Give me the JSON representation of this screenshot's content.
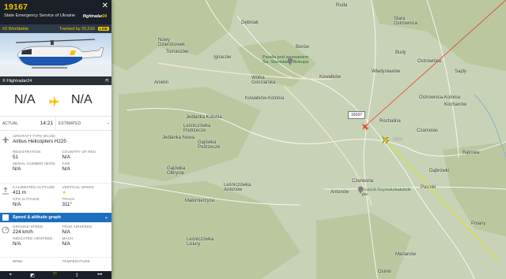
{
  "flight": {
    "callsign": "19167",
    "operator": "State Emergency Service of Ukraine",
    "rank": "#3 Worldwide",
    "tracked_by": "Tracked by 20,516",
    "badge": "LIVE",
    "photo_credit": "© Flightradar24",
    "logo": "flightradar",
    "logo_num": "24",
    "origin": "N/A",
    "destination": "N/A"
  },
  "times": {
    "actual_label": "ACTUAL",
    "actual_value": "14:21",
    "estimated_label": "ESTIMATED",
    "estimated_value": "-"
  },
  "details": {
    "aircraft_type_label": "AIRCRAFT TYPE (EC25)",
    "aircraft_type": "Airbus Helicopters H225",
    "registration_label": "REGISTRATION",
    "registration": "51",
    "country_label": "COUNTRY OF REG.",
    "country": "N/A",
    "serial_label": "SERIAL NUMBER (MSN)",
    "serial": "N/A",
    "age_label": "AGE",
    "age": "N/A",
    "cal_alt_label": "CALIBRATED ALTITUDE",
    "cal_alt": "411 m",
    "vert_speed_label": "VERTICAL SPEED",
    "gps_alt_label": "GPS ALTITUDE",
    "gps_alt": "N/A",
    "track_label": "TRACK",
    "track": "311°",
    "graph_label": "Speed & altitude graph",
    "ground_speed_label": "GROUND SPEED",
    "ground_speed": "224 km/h",
    "true_airspeed_label": "TRUE AIRSPEED",
    "true_airspeed": "N/A",
    "ind_airspeed_label": "INDICATED AIRSPEED",
    "ind_airspeed": "N/A",
    "mach_label": "MACH",
    "mach": "N/A",
    "wind_label": "WIND",
    "temp_label": "TEMPERATURE"
  },
  "map": {
    "aircraft_label": "19167",
    "other_label": "19171",
    "places": {
      "ruda": "Ruda",
      "debniak": "Dębniak",
      "stara_ostrownica": "Stara Ostrownica",
      "nowy_dzierzkowek": "Nowy Dzierzkowek",
      "tomaszow": "Tomaszów",
      "borow": "Borów",
      "ignacow": "Ignaców",
      "parafia": "Parafia pod wezwaniem Św. Stanisława Biskupa",
      "budy": "Budy",
      "ostrownica": "Ostrownica",
      "wolka_gonciarska": "Wólka Gonciarska",
      "wladyslawow": "Władysławów",
      "sajdy": "Sajdy",
      "anielin": "Anielin",
      "kowalkow": "Kowalków",
      "kowalkow_kolonia": "Kowalków-Kolonia",
      "ostrownica_kolonia": "Ostrownica-Kolonia",
      "kochanow": "Kochanów",
      "jedlanka_kolonia": "Jedlanka Kolonia",
      "rochalina": "Rochalina",
      "lesnicowka_podrzecze": "Leśniczówka Podrzecze",
      "czarnolas": "Czarnolas",
      "gajowka_podrzecze": "Gajówka Podrzecze",
      "jedlanka_nowa": "Jedlanka Nowa",
      "bakowa": "Bąkowa",
      "gajowka_olbrycie": "Gajówka Olbrycie",
      "dabrowki": "Dąbrówki",
      "lesniczowka_antonow": "Leśniczówka Antonów",
      "czerwona": "Czerwona",
      "antonow": "Antonów",
      "kosciol": "Kościół Rzymskokatolicki pw.",
      "pasieki": "Pasieki",
      "malomierzyce": "Małomierzyce",
      "polany": "Polany",
      "lesniczowka_lisiury": "Leśniczówka Lisiury",
      "marianow": "Marianów",
      "osinki": "Osinki"
    }
  },
  "colors": {
    "header_bg": "#1b1f27",
    "accent_yellow": "#f5c400",
    "graph_blue": "#1c6fbf",
    "track_line": "#d6e23a",
    "aircraft_red": "#e8412c"
  },
  "icons": [
    "close-icon",
    "share-icon",
    "airplane-icon",
    "altitude-icon",
    "speed-icon",
    "chart-icon",
    "chevron-down-icon",
    "more-icon"
  ]
}
